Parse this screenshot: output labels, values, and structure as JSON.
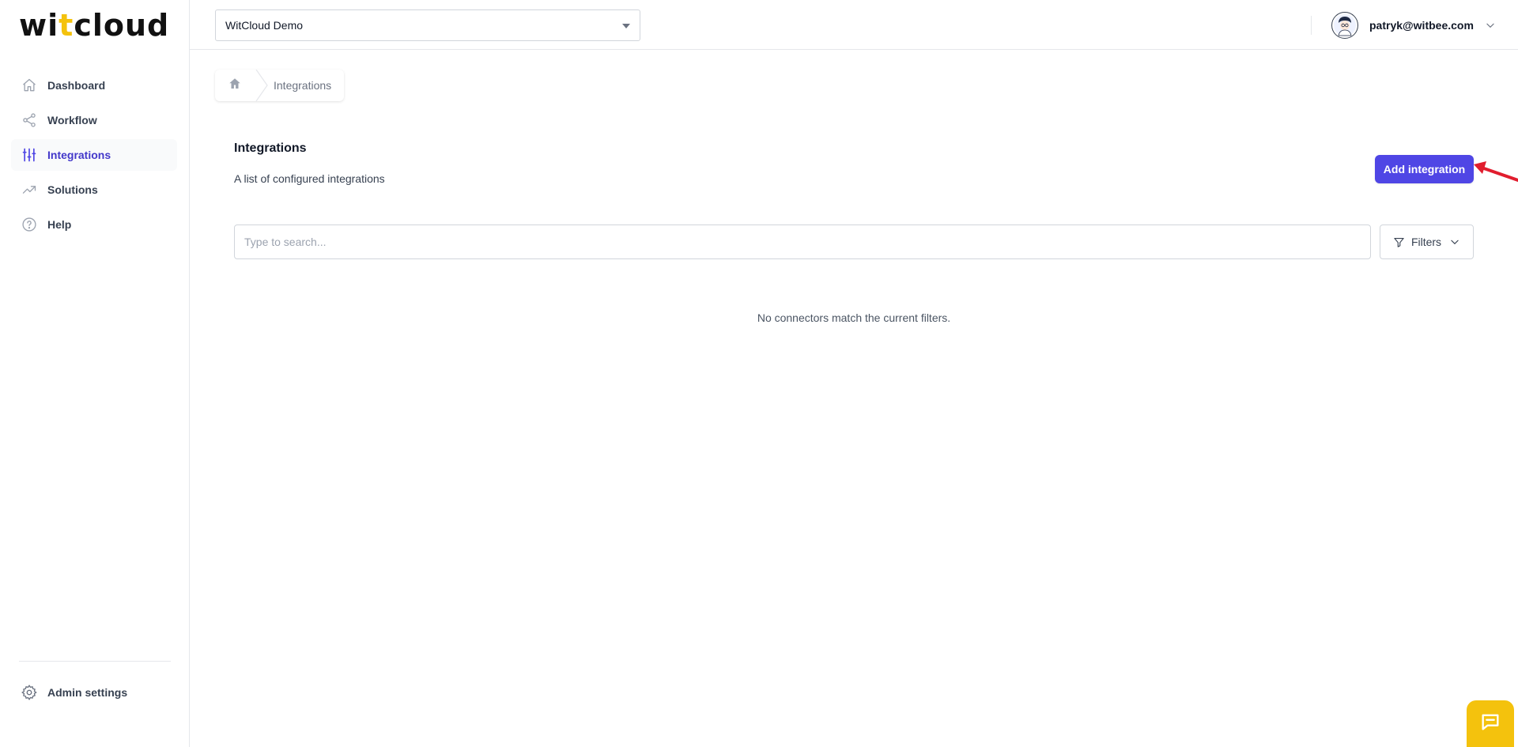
{
  "brand": {
    "logo_left": "wi",
    "logo_accent": "t",
    "logo_right": "cloud",
    "accent_color": "#f4c20d",
    "primary_color": "#4f46e5"
  },
  "sidebar": {
    "items": [
      {
        "label": "Dashboard",
        "icon": "home-icon",
        "active": false
      },
      {
        "label": "Workflow",
        "icon": "share-icon",
        "active": false
      },
      {
        "label": "Integrations",
        "icon": "sliders-icon",
        "active": true
      },
      {
        "label": "Solutions",
        "icon": "trending-up-icon",
        "active": false
      },
      {
        "label": "Help",
        "icon": "question-circle-icon",
        "active": false
      }
    ],
    "admin_label": "Admin settings"
  },
  "topbar": {
    "org_select_value": "WitCloud Demo",
    "user_email": "patryk@witbee.com"
  },
  "breadcrumb": {
    "current": "Integrations"
  },
  "main": {
    "title": "Integrations",
    "subtitle": "A list of configured integrations",
    "add_button_label": "Add integration",
    "search_placeholder": "Type to search...",
    "filters_label": "Filters",
    "empty_message": "No connectors match the current filters."
  }
}
